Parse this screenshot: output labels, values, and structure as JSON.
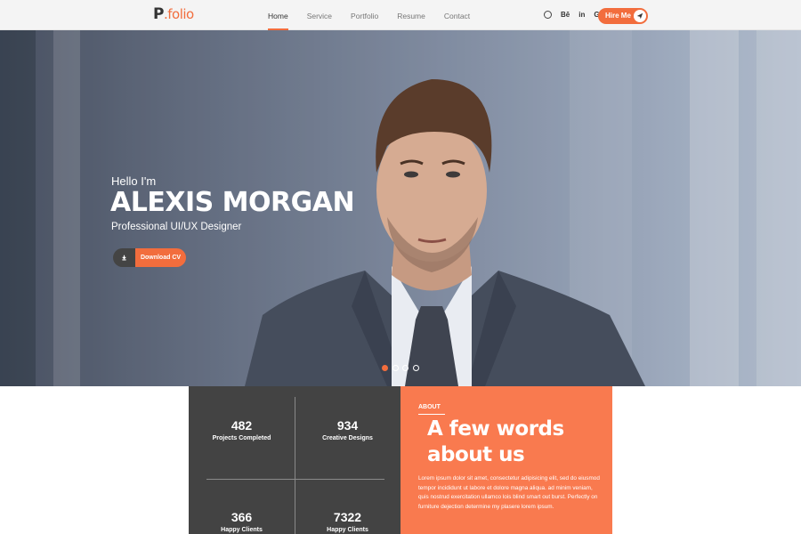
{
  "brand": {
    "logo_main": "P",
    "logo_accent": ".folio"
  },
  "nav": {
    "items": [
      {
        "label": "Home",
        "active": true
      },
      {
        "label": "Service",
        "active": false
      },
      {
        "label": "Portfolio",
        "active": false
      },
      {
        "label": "Resume",
        "active": false
      },
      {
        "label": "Contact",
        "active": false
      }
    ]
  },
  "social": {
    "behance": "Bē",
    "linkedin": "in",
    "google_plus": "G+"
  },
  "hire": {
    "label": "Hire Me"
  },
  "hero": {
    "greeting": "Hello I'm",
    "name": "ALEXIS MORGAN",
    "role": "Professional UI/UX Designer",
    "download_label": "Download CV",
    "slides": 4,
    "active_slide": 1
  },
  "stats": [
    {
      "value": "482",
      "label": "Projects Completed"
    },
    {
      "value": "934",
      "label": "Creative Designs"
    },
    {
      "value": "366",
      "label": "Happy Clients"
    },
    {
      "value": "7322",
      "label": "Happy Clients"
    }
  ],
  "about": {
    "tag": "ABOUT",
    "heading_line1": "A few words",
    "heading_line2": "about us",
    "body": "Lorem ipsum dolor sit amet, consectetur adipisicing elit, sed do eiusmod tempor incididunt ut labore et dolore magna aliqua. ad minim veniam, quis nostrud exercitation ullamco lois blind smart out burst. Perfectly on furniture dejection determine my plasere lorem ipsum."
  },
  "colors": {
    "accent": "#f26d3d",
    "about_bg": "#f97a4f",
    "stats_bg": "#434343",
    "navbar_bg": "#f4f4f4"
  }
}
